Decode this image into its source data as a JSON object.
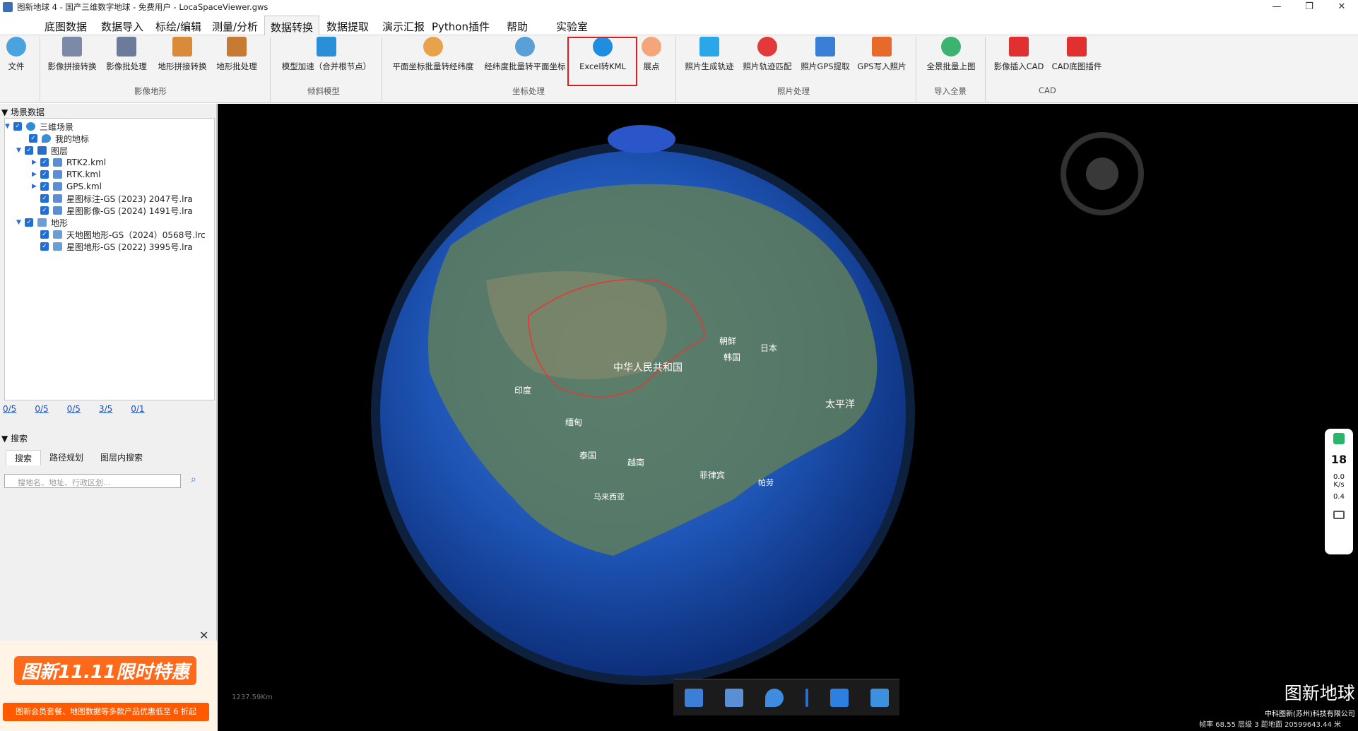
{
  "window": {
    "title": "图新地球 4 - 国产三维数字地球 - 免费用户 - LocaSpaceViewer.gws",
    "min": "—",
    "max": "❐",
    "close": "✕"
  },
  "menu": [
    "底图数据",
    "数据导入",
    "标绘/编辑",
    "测量/分析",
    "数据转换",
    "数据提取",
    "演示汇报",
    "Python插件",
    "帮助",
    "实验室"
  ],
  "ribbon": {
    "file": "文件",
    "buttons": [
      "影像拼接转换",
      "影像批处理",
      "地形拼接转换",
      "地形批处理",
      "模型加速（合并根节点）",
      "平面坐标批量转经纬度",
      "经纬度批量转平面坐标",
      "Excel转KML",
      "展点",
      "照片生成轨迹",
      "照片轨迹匹配",
      "照片GPS提取",
      "GPS写入照片",
      "全景批量上图",
      "影像插入CAD",
      "CAD底图插件"
    ],
    "groups": [
      "影像地形",
      "倾斜模型",
      "坐标处理",
      "照片处理",
      "导入全景",
      "CAD"
    ],
    "highlighted": "Excel转KML"
  },
  "left": {
    "scene_title": "场景数据",
    "tree": [
      "三维场景",
      "我的地标",
      "图层",
      "RTK2.kml",
      "RTK.kml",
      "GPS.kml",
      "星图标注-GS (2023) 2047号.lra",
      "星图影像-GS (2024) 1491号.lra",
      "地形",
      "天地图地形-GS（2024）0568号.lrc",
      "星图地形-GS (2022) 3995号.lra"
    ],
    "stats": [
      "0/5",
      "0/5",
      "0/5",
      "3/5",
      "0/1"
    ],
    "search_title": "搜索",
    "tabs": [
      "搜索",
      "路径规划",
      "图层内搜索"
    ],
    "search_placeholder": "搜地名、地址、行政区划...",
    "promo_title": "图新11.11限时特惠",
    "promo_sub": "图新会员套餐、地图数据等多款产品优惠低至 6 折起",
    "close": "✕"
  },
  "viewer": {
    "labels": [
      "中华人民共和国",
      "朝鲜",
      "韩国",
      "日本",
      "印度",
      "缅甸",
      "泰国",
      "越南",
      "菲律宾",
      "马来西亚",
      "帕劳",
      "太平洋"
    ],
    "brand": "图新地球",
    "company": "中科图新(苏州)科技有限公司",
    "scale": "1237.59Km",
    "monitor": {
      "pct": "18",
      "up": "0.0",
      "down": "0.4",
      "unit": "K/s"
    },
    "status": "帧率 68.55  层级 3  距地面 20599643.44 米"
  }
}
